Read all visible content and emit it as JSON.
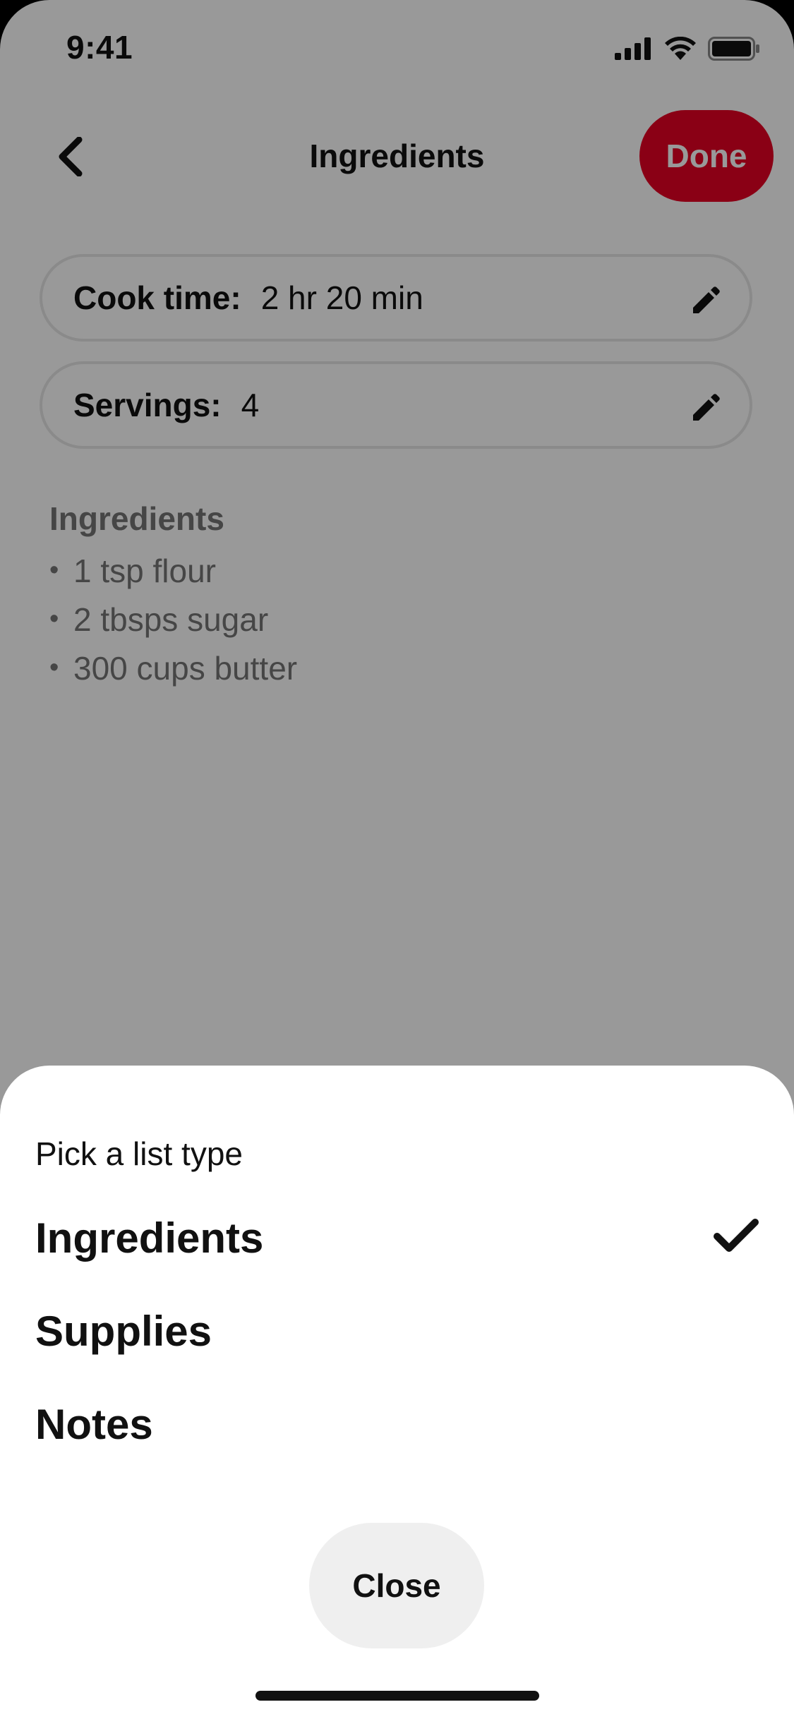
{
  "status_bar": {
    "time": "9:41",
    "icons": [
      "cellular-signal-icon",
      "wifi-icon",
      "battery-icon"
    ]
  },
  "nav": {
    "back_icon": "chevron-left-icon",
    "title": "Ingredients",
    "done_label": "Done"
  },
  "fields": [
    {
      "label": "Cook time:",
      "value": "2 hr 20 min",
      "icon": "pencil-icon"
    },
    {
      "label": "Servings:",
      "value": "4",
      "icon": "pencil-icon"
    }
  ],
  "list": {
    "heading": "Ingredients",
    "bullet": "•",
    "items": [
      "1 tsp flour",
      "2 tbsps sugar",
      "300 cups butter"
    ]
  },
  "sheet": {
    "title": "Pick a list type",
    "options": [
      {
        "label": "Ingredients",
        "selected": true
      },
      {
        "label": "Supplies",
        "selected": false
      },
      {
        "label": "Notes",
        "selected": false
      }
    ],
    "check_icon": "checkmark-icon",
    "close_label": "Close"
  },
  "colors": {
    "accent": "#e60023",
    "text": "#111111",
    "muted_text": "#767676",
    "close_bg": "#efefef",
    "scrim": "rgba(0,0,0,0.40)"
  }
}
